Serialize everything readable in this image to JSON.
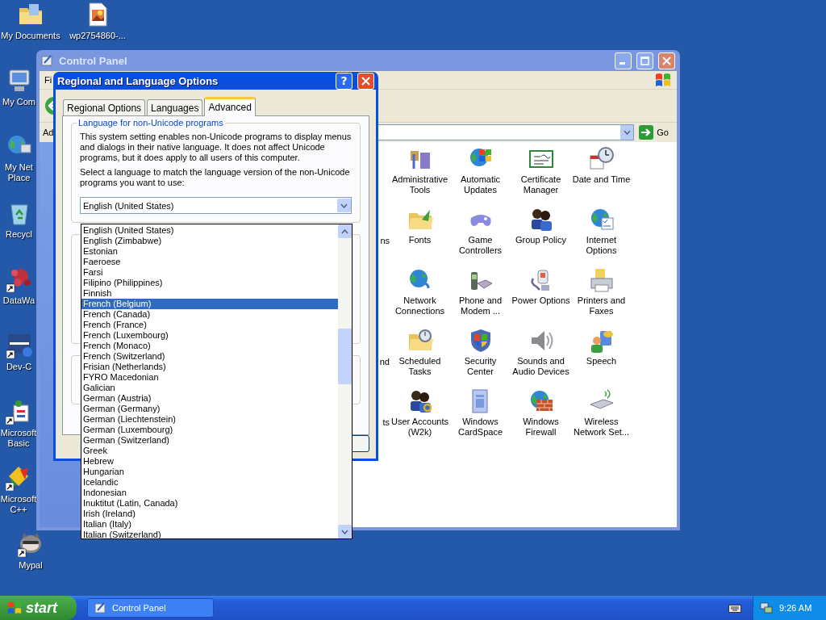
{
  "desktop": {
    "icons": [
      {
        "label": "My Documents"
      },
      {
        "label": "wp2754860-..."
      },
      {
        "label": "My Com"
      },
      {
        "label": "My Net Place"
      },
      {
        "label": "Recycl"
      },
      {
        "label": "DataWa"
      },
      {
        "label": "Dev-C"
      },
      {
        "label": "Microsoft Basic"
      },
      {
        "label": "Microsoft C++"
      },
      {
        "label": "Mypal"
      }
    ]
  },
  "control_panel": {
    "title": "Control Panel",
    "menu": "Fi",
    "address_label": "Ad",
    "go_label": "Go",
    "rows": [
      {
        "items": [
          {
            "label": "Administrative Tools"
          },
          {
            "label": "Automatic Updates"
          },
          {
            "label": "Certificate Manager"
          },
          {
            "label": "Date and Time"
          }
        ]
      },
      {
        "cut_label": "ns",
        "items": [
          {
            "label": "Fonts"
          },
          {
            "label": "Game Controllers"
          },
          {
            "label": "Group Policy"
          },
          {
            "label": "Internet Options"
          }
        ]
      },
      {
        "items": [
          {
            "label": "Network Connections"
          },
          {
            "label": "Phone and Modem ..."
          },
          {
            "label": "Power Options"
          },
          {
            "label": "Printers and Faxes"
          }
        ]
      },
      {
        "cut_label": "nd",
        "items": [
          {
            "label": "Scheduled Tasks"
          },
          {
            "label": "Security Center"
          },
          {
            "label": "Sounds and Audio Devices"
          },
          {
            "label": "Speech"
          }
        ]
      },
      {
        "cut_label": "ts",
        "items": [
          {
            "label": "User Accounts (W2k)"
          },
          {
            "label": "Windows CardSpace"
          },
          {
            "label": "Windows Firewall"
          },
          {
            "label": "Wireless Network Set..."
          }
        ]
      }
    ]
  },
  "dialog": {
    "title": "Regional and Language Options",
    "help_label": "?",
    "tabs": [
      {
        "label": "Regional Options",
        "selected": false
      },
      {
        "label": "Languages",
        "selected": false
      },
      {
        "label": "Advanced",
        "selected": true
      }
    ],
    "group_title": "Language for non-Unicode programs",
    "description": "This system setting enables non-Unicode programs to display menus and dialogs in their native language. It does not affect Unicode programs, but it does apply to all users of this computer.",
    "instruction": "Select a language to match the language version of the non-Unicode programs you want to use:",
    "combo_value": "English (United States)",
    "options": [
      {
        "label": "English (United States)",
        "selected": false
      },
      {
        "label": "English (Zimbabwe)",
        "selected": false
      },
      {
        "label": "Estonian",
        "selected": false
      },
      {
        "label": "Faeroese",
        "selected": false
      },
      {
        "label": "Farsi",
        "selected": false
      },
      {
        "label": "Filipino (Philippines)",
        "selected": false
      },
      {
        "label": "Finnish",
        "selected": false
      },
      {
        "label": "French (Belgium)",
        "selected": true
      },
      {
        "label": "French (Canada)",
        "selected": false
      },
      {
        "label": "French (France)",
        "selected": false
      },
      {
        "label": "French (Luxembourg)",
        "selected": false
      },
      {
        "label": "French (Monaco)",
        "selected": false
      },
      {
        "label": "French (Switzerland)",
        "selected": false
      },
      {
        "label": "Frisian (Netherlands)",
        "selected": false
      },
      {
        "label": "FYRO Macedonian",
        "selected": false
      },
      {
        "label": "Galician",
        "selected": false
      },
      {
        "label": "German (Austria)",
        "selected": false
      },
      {
        "label": "German (Germany)",
        "selected": false
      },
      {
        "label": "German (Liechtenstein)",
        "selected": false
      },
      {
        "label": "German (Luxembourg)",
        "selected": false
      },
      {
        "label": "German (Switzerland)",
        "selected": false
      },
      {
        "label": "Greek",
        "selected": false
      },
      {
        "label": "Hebrew",
        "selected": false
      },
      {
        "label": "Hungarian",
        "selected": false
      },
      {
        "label": "Icelandic",
        "selected": false
      },
      {
        "label": "Indonesian",
        "selected": false
      },
      {
        "label": "Inuktitut (Latin, Canada)",
        "selected": false
      },
      {
        "label": "Irish (Ireland)",
        "selected": false
      },
      {
        "label": "Italian (Italy)",
        "selected": false
      },
      {
        "label": "Italian (Switzerland)",
        "selected": false
      }
    ]
  },
  "taskbar": {
    "start_label": "start",
    "tasks": [
      {
        "label": "Control Panel"
      }
    ],
    "clock": "9:26 AM"
  }
}
